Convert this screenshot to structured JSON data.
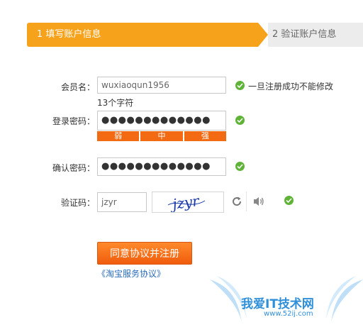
{
  "steps": [
    {
      "label": "1 填写账户信息"
    },
    {
      "label": "2 验证账户信息"
    }
  ],
  "form": {
    "username": {
      "label": "会员名：",
      "value": "wuxiaoqun1956",
      "hint": "一旦注册成功不能修改",
      "count": "13个字符"
    },
    "password": {
      "label": "登录密码：",
      "value": "●●●●●●●●●●●●●"
    },
    "strength": {
      "weak": "弱",
      "medium": "中",
      "strong": "强"
    },
    "confirm": {
      "label": "确认密码：",
      "value": "●●●●●●●●●●●●●"
    },
    "captcha": {
      "label": "验证码：",
      "value": "jzyr",
      "image_text": "jzyr"
    }
  },
  "actions": {
    "submit_label": "同意协议并注册",
    "agreement_link": "《淘宝服务协议》"
  },
  "watermark": {
    "text": "我爱IT技术网",
    "url": "www.52ij.com"
  },
  "colors": {
    "step_active": "#f7a21b",
    "strength_bar": "#f26b13",
    "ok_icon": "#5fb336",
    "link": "#2a6bb8"
  }
}
